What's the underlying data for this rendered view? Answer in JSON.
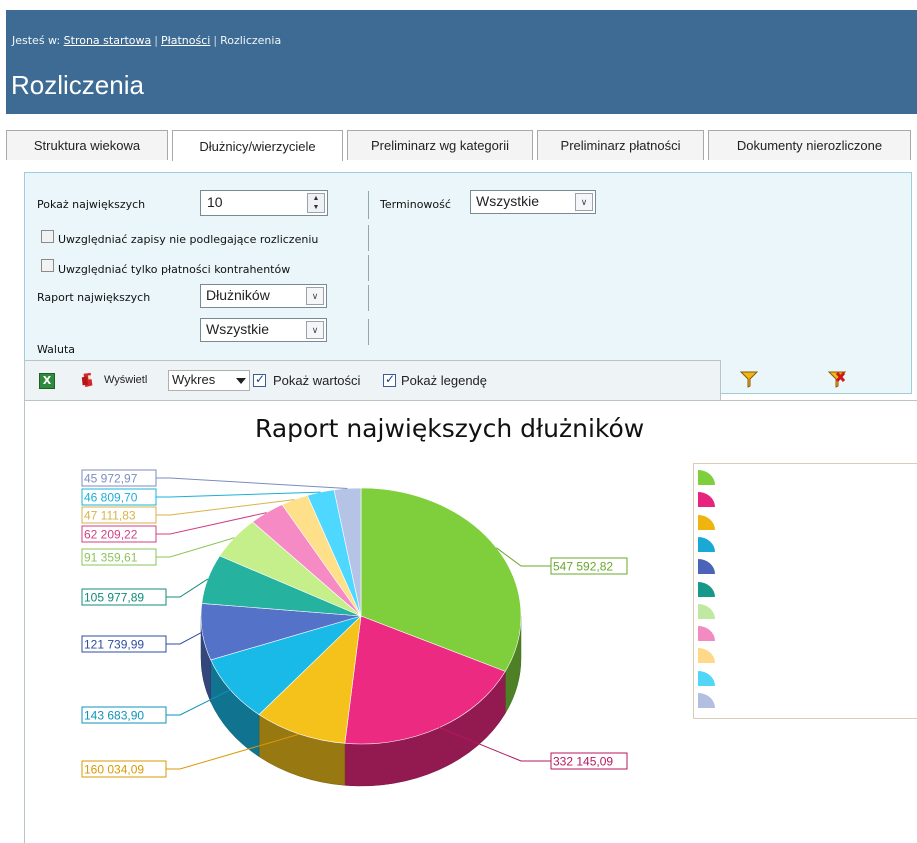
{
  "breadcrumb": {
    "prefix": "Jesteś w:",
    "home": "Strona startowa",
    "payments": "Płatności",
    "current": "Rozliczenia"
  },
  "page_title": "Rozliczenia",
  "tabs": [
    {
      "label": "Struktura wiekowa",
      "active": false
    },
    {
      "label": "Dłużnicy/wierzyciele",
      "active": true
    },
    {
      "label": "Preliminarz wg kategorii",
      "active": false
    },
    {
      "label": "Preliminarz płatności",
      "active": false
    },
    {
      "label": "Dokumenty nierozliczone",
      "active": false
    }
  ],
  "filters": {
    "show_largest_label": "Pokaż największych",
    "show_largest_value": "10",
    "terminowosc_label": "Terminowość",
    "terminowosc_value": "Wszystkie",
    "include_unsettled_label": "Uwzględniać zapisy nie podlegające rozliczeniu",
    "include_unsettled_checked": false,
    "only_contractor_label": "Uwzględniać tylko płatności kontrahentów",
    "only_contractor_checked": false,
    "report_label": "Raport największych",
    "report_value": "Dłużników",
    "currency_label": "Waluta",
    "currency_value": "Wszystkie"
  },
  "toolbar": {
    "excel_icon": "excel-icon",
    "pdf_icon": "pdf-icon",
    "display_label": "Wyświetl",
    "display_value": "Wykres",
    "show_values_label": "Pokaż wartości",
    "show_values_checked": true,
    "show_legend_label": "Pokaż legendę",
    "show_legend_checked": true
  },
  "filter_icons": [
    "filter-icon",
    "clear-filter-icon"
  ],
  "colors": {
    "header_bg": "#3d6b94",
    "panel_bg": "#eaf6f9"
  },
  "chart_data": {
    "type": "pie",
    "title": "Raport największych dłużników",
    "slices": [
      {
        "label": "547 592,82",
        "value": 547592.82,
        "color": "#7ecf3b"
      },
      {
        "label": "332 145,09",
        "value": 332145.09,
        "color": "#ec2a82"
      },
      {
        "label": "160 034,09",
        "value": 160034.09,
        "color": "#f4c21b"
      },
      {
        "label": "143 683,90",
        "value": 143683.9,
        "color": "#19b9e8"
      },
      {
        "label": "121 739,99",
        "value": 121739.99,
        "color": "#5472c8"
      },
      {
        "label": "105 977,89",
        "value": 105977.89,
        "color": "#25b29f"
      },
      {
        "label": "91 359,61",
        "value": 91359.61,
        "color": "#c5ef8b"
      },
      {
        "label": "62 209,22",
        "value": 62209.22,
        "color": "#f68ac4"
      },
      {
        "label": "47 111,83",
        "value": 47111.83,
        "color": "#ffe08a"
      },
      {
        "label": "46 809,70",
        "value": 46809.7,
        "color": "#4fd8ff"
      },
      {
        "label": "45 972,97",
        "value": 45972.97,
        "color": "#b5c4e6"
      }
    ],
    "label_colors": [
      "#6aa82c",
      "#b5175f",
      "#d99a05",
      "#0d93bb",
      "#2f4d9e",
      "#0f8b7b",
      "#8cc45a",
      "#d23f86",
      "#d9b24a",
      "#1ab0d8",
      "#7c8dbf"
    ],
    "legend_colors": [
      "#7ecf3b",
      "#e8237e",
      "#f0b40f",
      "#1aa8d4",
      "#4b63b8",
      "#17998a",
      "#bfe8a0",
      "#f28bc0",
      "#ffd88a",
      "#52d6f7",
      "#b2bfe0"
    ],
    "legend": "right",
    "show_values": true
  }
}
